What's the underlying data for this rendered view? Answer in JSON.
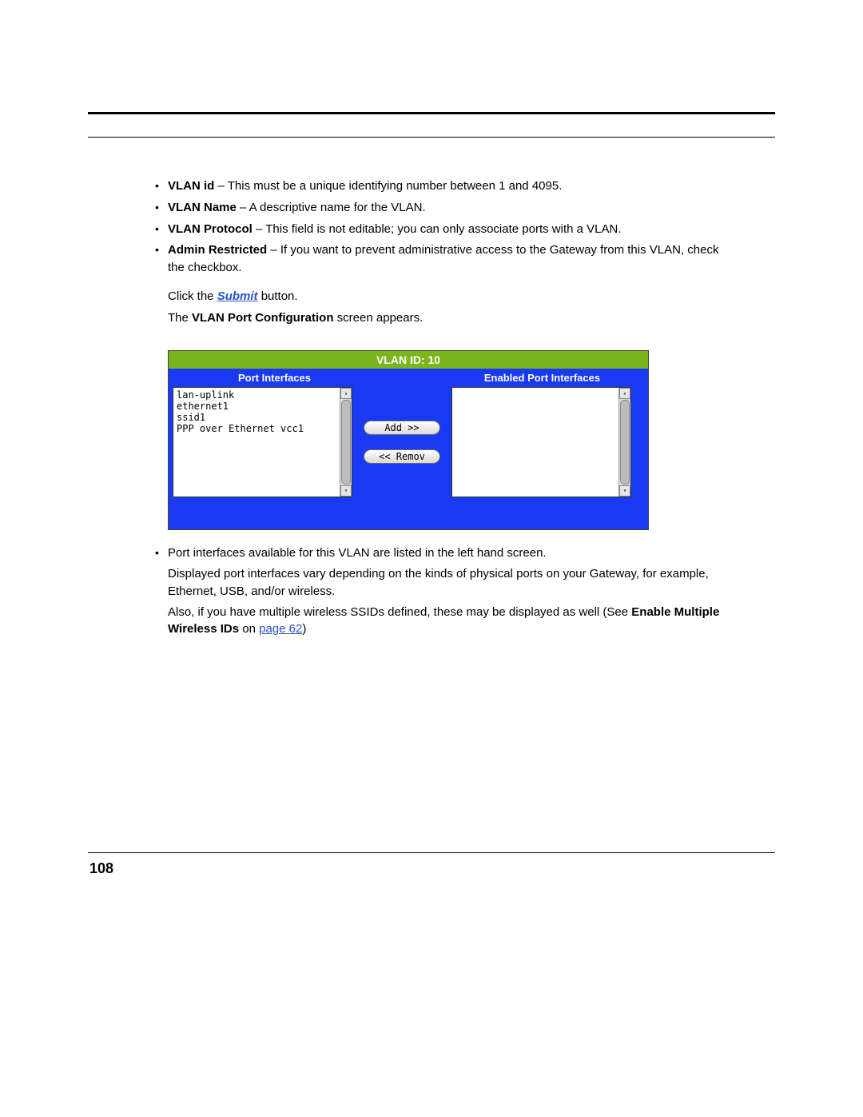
{
  "bullets_top": [
    {
      "label": "VLAN id",
      "text": " – This must be a unique identifying number between 1 and 4095."
    },
    {
      "label": "VLAN Name",
      "text": " – A descriptive name for the VLAN."
    },
    {
      "label": "VLAN Protocol",
      "text": " – This field is not editable; you can only associate ports with a VLAN."
    },
    {
      "label": "Admin Restricted",
      "text": " – If you want to prevent administrative access to the Gateway from this VLAN, check the checkbox."
    }
  ],
  "click_the": "Click the ",
  "submit_label": "Submit",
  "button_suffix": " button.",
  "appears_prefix": "The ",
  "appears_bold": "VLAN Port Configuration",
  "appears_suffix": " screen appears.",
  "panel": {
    "title": "VLAN ID: 10",
    "left_header": "Port Interfaces",
    "right_header": "Enabled Port Interfaces",
    "items": [
      "lan-uplink",
      "ethernet1",
      "ssid1",
      "PPP over Ethernet vcc1"
    ],
    "add_label": "Add >>",
    "remove_label": "<< Remov"
  },
  "bullets_bottom_lead": "Port interfaces available for this VLAN are listed in the left hand screen.",
  "para2": "Displayed port interfaces vary depending on the kinds of physical ports on your Gateway, for example, Ethernet, USB, and/or wireless.",
  "para3_prefix": "Also, if you have multiple wireless SSIDs defined, these may be displayed as well (See ",
  "para3_bold": "Enable Multiple Wireless IDs",
  "para3_on": " on ",
  "para3_link": "page 62",
  "para3_close": ")",
  "page_number": "108"
}
